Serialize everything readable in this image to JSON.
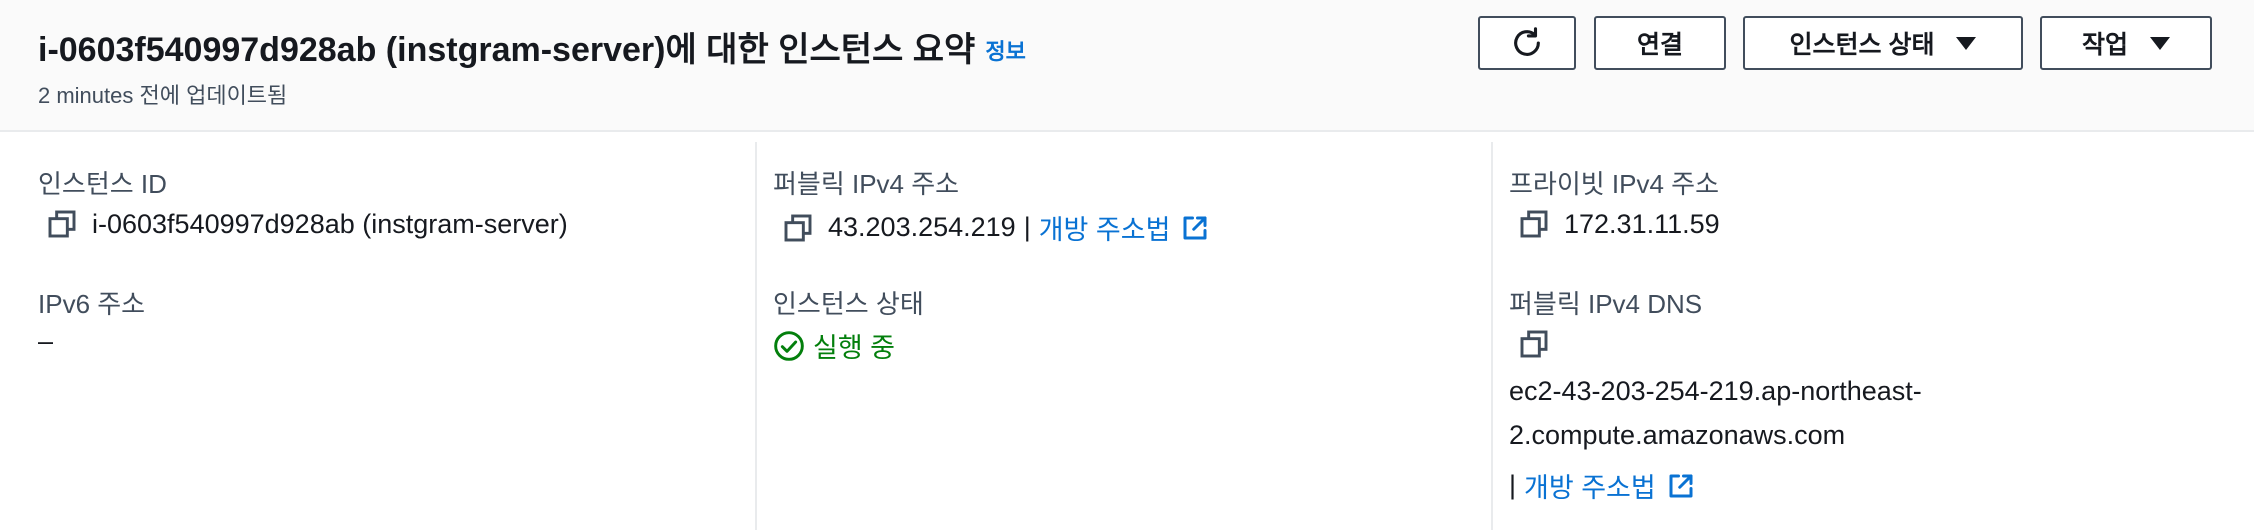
{
  "header": {
    "title": "i-0603f540997d928ab (instgram-server)에 대한 인스턴스 요약",
    "info_link": "정보",
    "subtitle": "2 minutes 전에 업데이트됨",
    "buttons": {
      "refresh_icon": "refresh-icon",
      "connect": "연결",
      "instance_state": "인스턴스 상태",
      "actions": "작업"
    }
  },
  "col1": {
    "instance_id_label": "인스턴스 ID",
    "instance_id_value": "i-0603f540997d928ab (instgram-server)",
    "ipv6_label": "IPv6 주소",
    "ipv6_value": "–"
  },
  "col2": {
    "public_ipv4_label": "퍼블릭 IPv4 주소",
    "public_ipv4_value": "43.203.254.219",
    "separator": "|",
    "open_address_link": "개방 주소법",
    "instance_state_label": "인스턴스 상태",
    "instance_state_value": "실행 중"
  },
  "col3": {
    "private_ipv4_label": "프라이빗 IPv4 주소",
    "private_ipv4_value": "172.31.11.59",
    "public_dns_label": "퍼블릭 IPv4 DNS",
    "public_dns_line1": "ec2-43-203-254-219.ap-northeast-",
    "public_dns_line2": "2.compute.amazonaws.com",
    "separator": "|",
    "open_address_link": "개방 주소법"
  },
  "colors": {
    "link": "#0972d3",
    "success": "#037f0c",
    "border": "#414d5c"
  }
}
